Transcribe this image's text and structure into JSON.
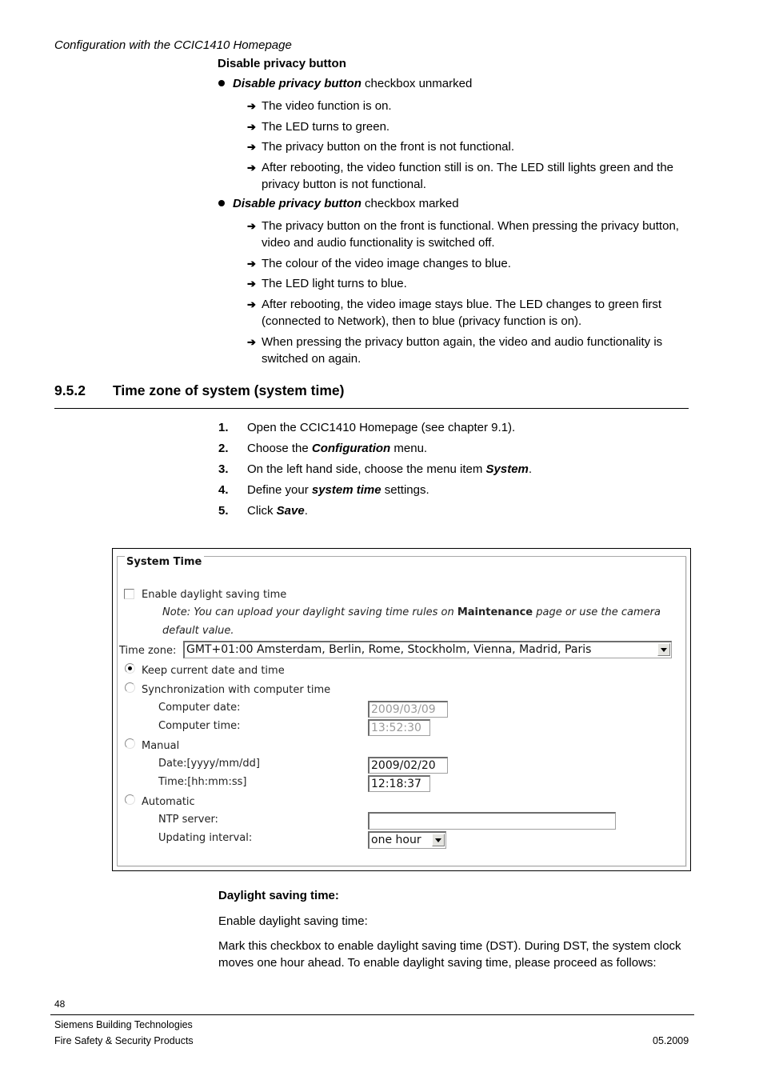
{
  "header": {
    "running_title": "Configuration with the CCIC1410 Homepage"
  },
  "privacy": {
    "heading": "Disable privacy button",
    "groups": [
      {
        "term": "Disable privacy button",
        "suffix": " checkbox unmarked",
        "items": [
          "The video function is on.",
          "The LED turns to green.",
          "The privacy button on the front is not functional.",
          "After rebooting, the video function still is on. The LED still lights green and the privacy button is not functional."
        ]
      },
      {
        "term": "Disable privacy button",
        "suffix": " checkbox marked",
        "items": [
          "The privacy button on the front is functional. When pressing the privacy button, video and audio functionality is switched off.",
          "The colour of the video image changes to blue.",
          "The LED light turns to blue.",
          "After rebooting, the video image stays blue. The LED changes to green first (connected to Network), then to blue (privacy function is on).",
          "When pressing the privacy button again, the video and audio functionality is switched on again."
        ]
      }
    ],
    "arrow_icon": "right-arrow-icon",
    "arrow_glyph": "➔"
  },
  "section": {
    "number": "9.5.2",
    "title": "Time zone of system (system time)",
    "steps": [
      {
        "num": "1.",
        "pre": "Open the CCIC1410 Homepage (see chapter 9.1).",
        "em": "",
        "post": ""
      },
      {
        "num": "2.",
        "pre": "Choose the ",
        "em": "Configuration",
        "post": " menu."
      },
      {
        "num": "3.",
        "pre": "On the left hand side, choose the menu item ",
        "em": "System",
        "post": "."
      },
      {
        "num": "4.",
        "pre": "Define your ",
        "em": "system time",
        "post": " settings."
      },
      {
        "num": "5.",
        "pre": "Click ",
        "em": "Save",
        "post": "."
      }
    ]
  },
  "system_time": {
    "legend": "System Time",
    "dst_checkbox": {
      "label": "Enable daylight saving time",
      "checked": false
    },
    "note": {
      "pre": "Note: You can upload your daylight saving time rules on ",
      "bold": "Maintenance",
      "post": " page or use the camera",
      "line2": "default value."
    },
    "timezone": {
      "label": "Time zone:",
      "value": "GMT+01:00 Amsterdam, Berlin, Rome, Stockholm, Vienna, Madrid, Paris"
    },
    "modes": [
      {
        "label": "Keep current date and time",
        "selected": true
      },
      {
        "label": "Synchronization with computer time",
        "selected": false
      },
      {
        "label": "Manual",
        "selected": false
      },
      {
        "label": "Automatic",
        "selected": false
      }
    ],
    "computer_date": {
      "label": "Computer date:",
      "value": "2009/03/09"
    },
    "computer_time": {
      "label": "Computer time:",
      "value": "13:52:30"
    },
    "manual_date": {
      "label": "Date:[yyyy/mm/dd]",
      "value": "2009/02/20"
    },
    "manual_time": {
      "label": "Time:[hh:mm:ss]",
      "value": "12:18:37"
    },
    "ntp_server": {
      "label": "NTP server:",
      "value": ""
    },
    "update_interval": {
      "label": "Updating interval:",
      "value": "one hour"
    }
  },
  "dst": {
    "heading": "Daylight saving time:",
    "line": "Enable daylight saving time:",
    "paragraph": "Mark this checkbox to enable daylight saving time (DST). During DST, the system clock moves one hour ahead. To enable daylight saving time, please proceed as follows:"
  },
  "footer": {
    "page_number": "48",
    "company": "Siemens Building Technologies",
    "division": "Fire Safety & Security Products",
    "date": "05.2009"
  }
}
